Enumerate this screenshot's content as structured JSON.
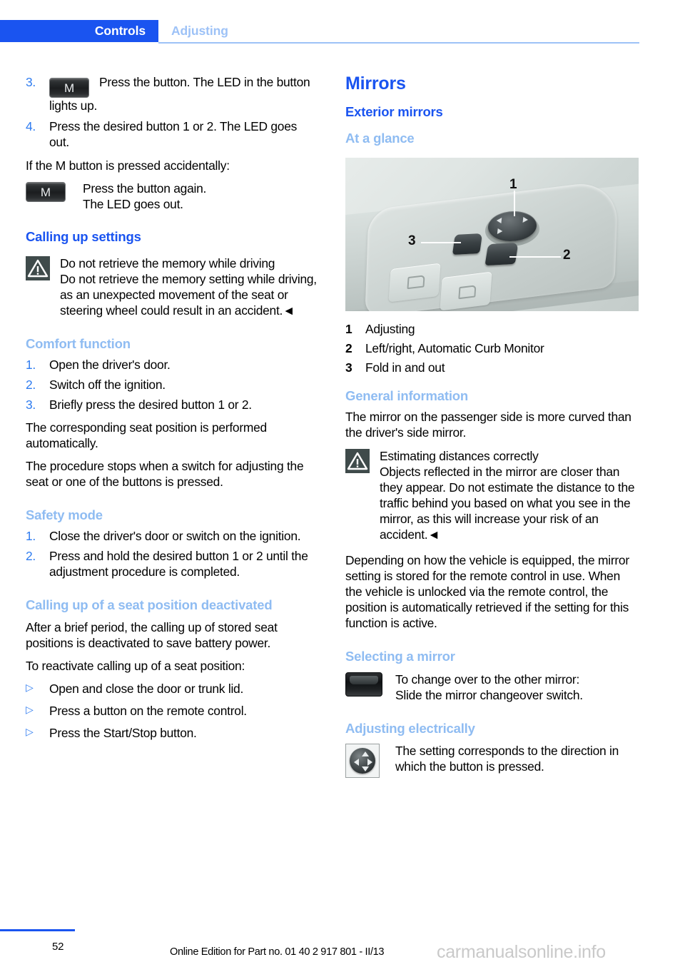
{
  "header": {
    "chapter": "Controls",
    "section": "Adjusting",
    "chapter_bg": "#1a54f0",
    "section_color": "#9dc2f7"
  },
  "left_column": {
    "steps_continued": [
      {
        "marker": "3.",
        "icon": "m-button-icon",
        "icon_label": "M",
        "text": "Press the button. The LED in the button lights up."
      },
      {
        "marker": "4.",
        "text": "Press the desired button 1 or 2. The LED goes out."
      }
    ],
    "accidental_intro": "If the M button is pressed accidentally:",
    "accidental_block": {
      "icon": "m-button-icon",
      "icon_label": "M",
      "line1": "Press the button again.",
      "line2": "The LED goes out."
    },
    "calling_up_settings": {
      "heading": "Calling up settings",
      "warning": {
        "icon": "warning-triangle-icon",
        "title": "Do not retrieve the memory while driving",
        "body": "Do not retrieve the memory setting while driving, as an unexpected movement of the seat or steering wheel could result in an accident.◄"
      }
    },
    "comfort_function": {
      "heading": "Comfort function",
      "steps": [
        {
          "marker": "1.",
          "text": "Open the driver's door."
        },
        {
          "marker": "2.",
          "text": "Switch off the ignition."
        },
        {
          "marker": "3.",
          "text": "Briefly press the desired button 1 or 2."
        }
      ],
      "para1": "The corresponding seat position is performed automatically.",
      "para2": "The procedure stops when a switch for adjusting the seat or one of the buttons is pressed."
    },
    "safety_mode": {
      "heading": "Safety mode",
      "steps": [
        {
          "marker": "1.",
          "text": "Close the driver's door or switch on the ignition."
        },
        {
          "marker": "2.",
          "text": "Press and hold the desired button 1 or 2 until the adjustment procedure is completed."
        }
      ]
    },
    "seat_position_deactivated": {
      "heading": "Calling up of a seat position deactivated",
      "para1": "After a brief period, the calling up of stored seat positions is deactivated to save battery power.",
      "para2": "To reactivate calling up of a seat position:",
      "bullets": [
        {
          "marker": "▷",
          "text": "Open and close the door or trunk lid."
        },
        {
          "marker": "▷",
          "text": "Press a button on the remote control."
        },
        {
          "marker": "▷",
          "text": "Press the Start/Stop button."
        }
      ]
    }
  },
  "right_column": {
    "title": "Mirrors",
    "subtitle": "Exterior mirrors",
    "at_a_glance": {
      "heading": "At a glance",
      "figure": {
        "name": "door-panel-mirror-controls-photo",
        "callouts": [
          "1",
          "2",
          "3"
        ]
      },
      "legend": [
        {
          "marker": "1",
          "text": "Adjusting"
        },
        {
          "marker": "2",
          "text": "Left/right, Automatic Curb Monitor"
        },
        {
          "marker": "3",
          "text": "Fold in and out"
        }
      ]
    },
    "general_information": {
      "heading": "General information",
      "para1": "The mirror on the passenger side is more curved than the driver's side mirror.",
      "warning": {
        "icon": "warning-triangle-icon",
        "title": "Estimating distances correctly",
        "body": "Objects reflected in the mirror are closer than they appear. Do not estimate the distance to the traffic behind you based on what you see in the mirror, as this will increase your risk of an accident.◄"
      },
      "para2": "Depending on how the vehicle is equipped, the mirror setting is stored for the remote control in use. When the vehicle is unlocked via the remote control, the position is automatically retrieved if the setting for this function is active."
    },
    "selecting_a_mirror": {
      "heading": "Selecting a mirror",
      "icon": "mirror-changeover-switch-icon",
      "line1": "To change over to the other mirror:",
      "line2": "Slide the mirror changeover switch."
    },
    "adjusting_electrically": {
      "heading": "Adjusting electrically",
      "icon": "joystick-button-icon",
      "text": "The setting corresponds to the direction in which the button is pressed."
    }
  },
  "footer": {
    "page_number": "52",
    "edition": "Online Edition for Part no. 01 40 2 917 801 - II/13",
    "watermark": "carmanualsonline.info"
  }
}
